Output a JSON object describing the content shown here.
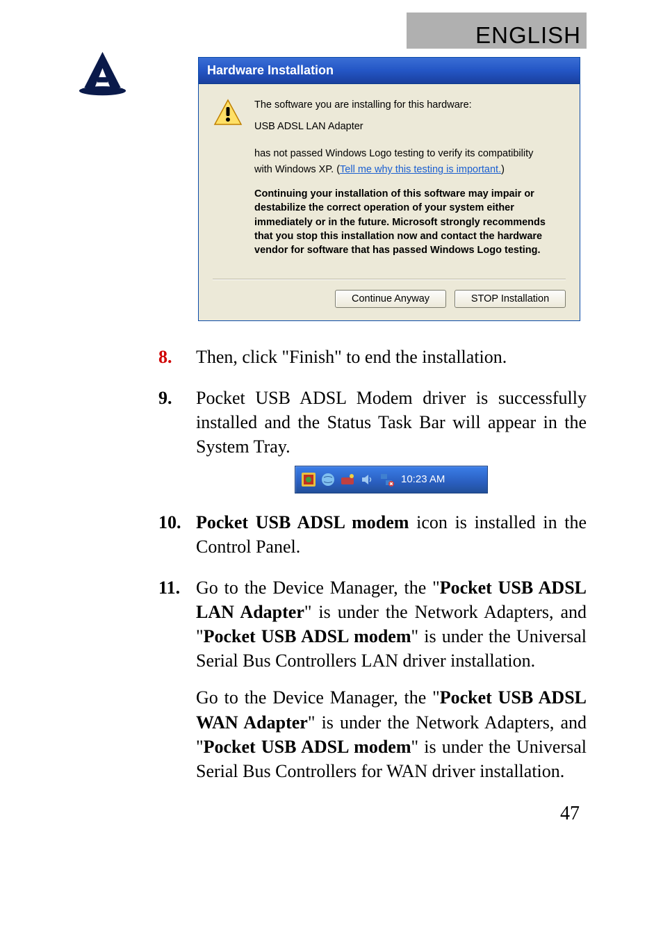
{
  "header": {
    "language": "ENGLISH"
  },
  "dialog": {
    "title": "Hardware Installation",
    "line1": "The software you are installing for this hardware:",
    "device": "USB ADSL LAN Adapter",
    "compat1": "has not passed Windows Logo testing to verify its compatibility",
    "compat2_prefix": "with Windows XP. (",
    "tell_me_link": "Tell me why this testing is important.",
    "compat2_suffix": ")",
    "bold_text": "Continuing your installation of this software may impair or destabilize the correct operation of your system either immediately or in the future. Microsoft strongly recommends that you stop this installation now and contact the hardware vendor for software that has passed Windows Logo testing.",
    "continue_btn": "Continue Anyway",
    "stop_btn": "STOP Installation"
  },
  "steps": {
    "s8_num": "8.",
    "s8_text": "Then, click \"Finish\" to end the installation.",
    "s9_num": "9.",
    "s9_text": "Pocket USB ADSL Modem driver is successfully installed and the Status Task Bar will appear in the System Tray.",
    "s10_num": "10.",
    "s10_prefix": "",
    "s10_bold": "Pocket USB ADSL modem",
    "s10_rest": " icon is installed in the Control Panel.",
    "s11_num": "11.",
    "s11_p1a": "Go to the Device Manager, the \"",
    "s11_p1b": "Pocket USB ADSL LAN Adapter",
    "s11_p1c": "\" is under the Network Adapters, and \"",
    "s11_p1d": "Pocket USB ADSL modem",
    "s11_p1e": "\" is under the Universal Serial Bus Controllers LAN driver installation.",
    "s11_p2a": "Go to the Device Manager, the \"",
    "s11_p2b": "Pocket USB ADSL WAN Adapter",
    "s11_p2c": "\" is under the Network Adapters, and \"",
    "s11_p2d": "Pocket USB ADSL modem",
    "s11_p2e": "\" is under the Universal Serial Bus Controllers for WAN driver installation."
  },
  "systray": {
    "time": "10:23 AM"
  },
  "page_number": "47"
}
